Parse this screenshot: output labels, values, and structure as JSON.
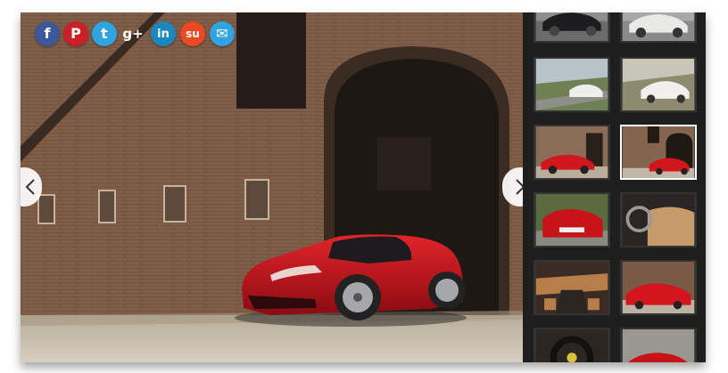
{
  "gallery": {
    "share": [
      {
        "network": "facebook",
        "glyph": "f",
        "color": "#3b5998",
        "icon": "facebook-icon"
      },
      {
        "network": "pinterest",
        "glyph": "P",
        "color": "#cb2027",
        "icon": "pinterest-icon"
      },
      {
        "network": "twitter",
        "glyph": "t",
        "color": "#2fa4e0",
        "icon": "twitter-icon"
      },
      {
        "network": "google-plus",
        "glyph": "g+",
        "color": "#ffffff",
        "icon": "google-plus-icon"
      },
      {
        "network": "linkedin",
        "glyph": "in",
        "color": "#1c87bd",
        "icon": "linkedin-icon"
      },
      {
        "network": "stumbleupon",
        "glyph": "su",
        "color": "#eb4924",
        "icon": "stumbleupon-icon"
      },
      {
        "network": "email",
        "glyph": "✉",
        "color": "#2fa4e0",
        "icon": "email-icon"
      }
    ],
    "prev_icon": "chevron-left-icon",
    "next_icon": "chevron-right-icon",
    "main_image": "red-sports-car-in-front-of-brick-building",
    "thumbnails": [
      {
        "subject": "black-sedan",
        "active": false
      },
      {
        "subject": "white-coupe",
        "active": false
      },
      {
        "subject": "white-coupe-road",
        "active": false
      },
      {
        "subject": "white-coupe-hills",
        "active": false
      },
      {
        "subject": "red-car-brick-wall",
        "active": false
      },
      {
        "subject": "red-car-archway",
        "active": true
      },
      {
        "subject": "red-car-rear",
        "active": false
      },
      {
        "subject": "tan-interior",
        "active": false
      },
      {
        "subject": "interior-dashboard",
        "active": false
      },
      {
        "subject": "red-car-front",
        "active": false
      },
      {
        "subject": "steering-wheel",
        "active": false
      },
      {
        "subject": "red-car-side",
        "active": false
      }
    ]
  }
}
